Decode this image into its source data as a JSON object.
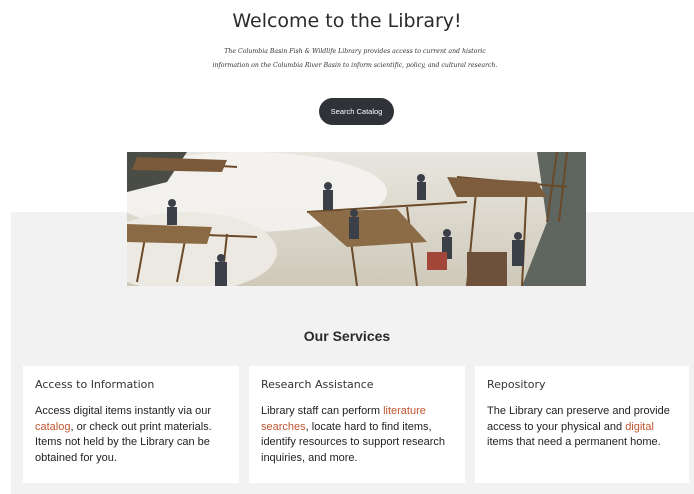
{
  "hero": {
    "title": "Welcome to the Library!",
    "description": "The Columbia Basin Fish & Wildlife Library provides access to current and historic information on the Columbia River Basin to inform scientific, policy, and cultural research.",
    "search_button": "Search Catalog"
  },
  "photo": {
    "subject": "historic photo of fishermen on wooden scaffolds over a waterfall"
  },
  "services": {
    "title": "Our Services",
    "cards": [
      {
        "heading": "Access to Information",
        "text_before": "Access digital items instantly via our ",
        "link": "catalog",
        "text_after": ", or check out print materials. Items not held by the Library can be obtained for you."
      },
      {
        "heading": "Research Assistance",
        "text_before": "Library staff can perform ",
        "link": "literature searches",
        "text_after": ", locate hard to find items, identify resources to support research inquiries, and more."
      },
      {
        "heading": "Repository",
        "text_before": "The Library can preserve and provide access to your physical and ",
        "link": "digital",
        "text_after": " items that need a permanent home."
      }
    ]
  },
  "colors": {
    "link": "#c0552f",
    "button": "#2f3338",
    "section_bg": "#f2f2f2"
  }
}
